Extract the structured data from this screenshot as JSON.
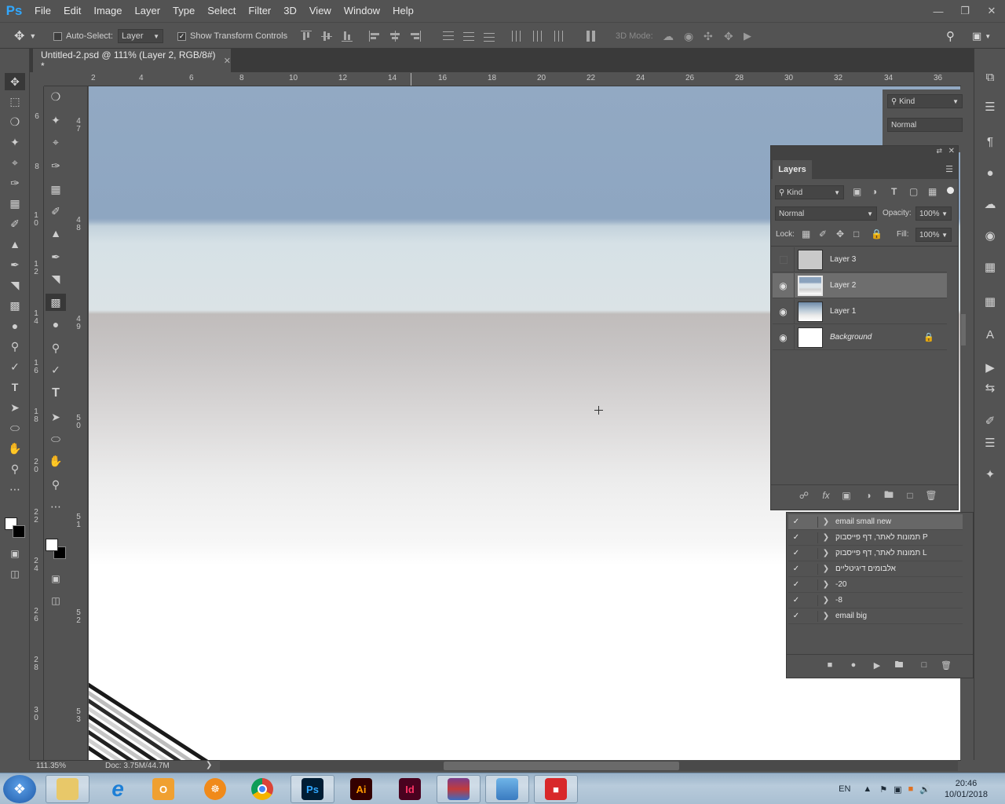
{
  "app": {
    "logo": "Ps",
    "menu": [
      "File",
      "Edit",
      "Image",
      "Layer",
      "Type",
      "Select",
      "Filter",
      "3D",
      "View",
      "Window",
      "Help"
    ]
  },
  "options_bar": {
    "auto_select_label": "Auto-Select:",
    "auto_select_target": "Layer",
    "show_transform_label": "Show Transform Controls",
    "show_transform_checked": true,
    "mode_3d_label": "3D Mode:"
  },
  "document": {
    "tab_title": "Untitled-2.psd @ 111% (Layer 2, RGB/8#) *",
    "zoom": "111.35%",
    "doc_size": "Doc: 3.75M/44.7M"
  },
  "ruler_top": [
    "2",
    "4",
    "6",
    "8",
    "10",
    "12",
    "14",
    "16",
    "18",
    "20",
    "22",
    "24",
    "26",
    "28",
    "30",
    "32",
    "34",
    "36"
  ],
  "ruler_left_a": [
    "6",
    "8",
    "10",
    "12",
    "14",
    "16",
    "18",
    "20",
    "22",
    "24",
    "26",
    "28",
    "30"
  ],
  "ruler_left_b": [
    "47",
    "48",
    "49",
    "50",
    "51",
    "52",
    "53"
  ],
  "behind_panel": {
    "kind_label": "Kind",
    "blend": "Normal"
  },
  "layers_panel": {
    "title": "Layers",
    "filter_label": "Kind",
    "blend_mode": "Normal",
    "opacity_label": "Opacity:",
    "opacity_value": "100%",
    "lock_label": "Lock:",
    "fill_label": "Fill:",
    "fill_value": "100%",
    "layers": [
      {
        "name": "Layer 3",
        "visible": false,
        "selected": false
      },
      {
        "name": "Layer 2",
        "visible": true,
        "selected": true
      },
      {
        "name": "Layer 1",
        "visible": true,
        "selected": false
      },
      {
        "name": "Background",
        "visible": true,
        "selected": false,
        "locked": true
      }
    ]
  },
  "actions_panel": {
    "actions": [
      "email small new",
      "תמונות לאתר, דף פייסבוק P",
      "תמונות לאתר, דף פייסבוק L",
      "אלבומים דיגיטליים",
      "-20",
      "-8",
      "email big"
    ]
  },
  "taskbar": {
    "language": "EN",
    "time": "20:46",
    "date": "10/01/2018",
    "apps": [
      "file-explorer",
      "internet-explorer",
      "outlook",
      "helm",
      "chrome",
      "photoshop",
      "illustrator",
      "indesign",
      "winrar",
      "photo-viewer",
      "sketchup"
    ],
    "ps_label": "Ps",
    "ai_label": "Ai",
    "id_label": "Id"
  },
  "colors": {
    "ps_blue": "#31a8ff",
    "panel_bg": "#535353",
    "selected_layer": "#6e6e6e"
  }
}
